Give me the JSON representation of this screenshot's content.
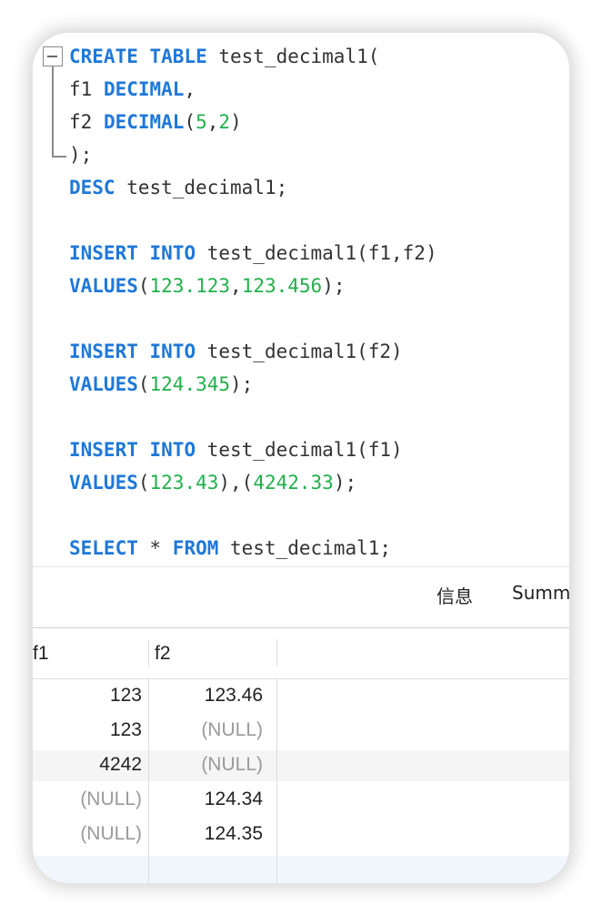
{
  "editor": {
    "lines": [
      [
        {
          "t": "CREATE",
          "k": "kw"
        },
        {
          "t": " ",
          "k": "plain"
        },
        {
          "t": "TABLE",
          "k": "kw"
        },
        {
          "t": " test_decimal1(",
          "k": "plain"
        }
      ],
      [
        {
          "t": "f1 ",
          "k": "plain"
        },
        {
          "t": "DECIMAL",
          "k": "kw"
        },
        {
          "t": ",",
          "k": "plain"
        }
      ],
      [
        {
          "t": "f2 ",
          "k": "plain"
        },
        {
          "t": "DECIMAL",
          "k": "kw"
        },
        {
          "t": "(",
          "k": "plain"
        },
        {
          "t": "5",
          "k": "num"
        },
        {
          "t": ",",
          "k": "plain"
        },
        {
          "t": "2",
          "k": "num"
        },
        {
          "t": ")",
          "k": "plain"
        }
      ],
      [
        {
          "t": ");",
          "k": "plain"
        }
      ],
      [
        {
          "t": "DESC",
          "k": "kw"
        },
        {
          "t": " test_decimal1;",
          "k": "plain"
        }
      ],
      [],
      [
        {
          "t": "INSERT",
          "k": "kw"
        },
        {
          "t": " ",
          "k": "plain"
        },
        {
          "t": "INTO",
          "k": "kw"
        },
        {
          "t": " test_decimal1(f1,f2)",
          "k": "plain"
        }
      ],
      [
        {
          "t": "VALUES",
          "k": "kw"
        },
        {
          "t": "(",
          "k": "plain"
        },
        {
          "t": "123.123",
          "k": "num"
        },
        {
          "t": ",",
          "k": "plain"
        },
        {
          "t": "123.456",
          "k": "num"
        },
        {
          "t": ");",
          "k": "plain"
        }
      ],
      [],
      [
        {
          "t": "INSERT",
          "k": "kw"
        },
        {
          "t": " ",
          "k": "plain"
        },
        {
          "t": "INTO",
          "k": "kw"
        },
        {
          "t": " test_decimal1(f2)",
          "k": "plain"
        }
      ],
      [
        {
          "t": "VALUES",
          "k": "kw"
        },
        {
          "t": "(",
          "k": "plain"
        },
        {
          "t": "124.345",
          "k": "num"
        },
        {
          "t": ");",
          "k": "plain"
        }
      ],
      [],
      [
        {
          "t": "INSERT",
          "k": "kw"
        },
        {
          "t": " ",
          "k": "plain"
        },
        {
          "t": "INTO",
          "k": "kw"
        },
        {
          "t": " test_decimal1(f1)",
          "k": "plain"
        }
      ],
      [
        {
          "t": "VALUES",
          "k": "kw"
        },
        {
          "t": "(",
          "k": "plain"
        },
        {
          "t": "123.43",
          "k": "num"
        },
        {
          "t": "),(",
          "k": "plain"
        },
        {
          "t": "4242.33",
          "k": "num"
        },
        {
          "t": ");",
          "k": "plain"
        }
      ],
      [],
      [
        {
          "t": "SELECT",
          "k": "kw"
        },
        {
          "t": " * ",
          "k": "plain"
        },
        {
          "t": "FROM",
          "k": "kw"
        },
        {
          "t": " test_decimal1;",
          "k": "plain"
        }
      ]
    ]
  },
  "tabs": {
    "info": "信息",
    "summary": "Summ"
  },
  "results": {
    "columns": [
      "f1",
      "f2"
    ],
    "rows": [
      [
        "123",
        "123.46"
      ],
      [
        "123",
        "(NULL)"
      ],
      [
        "4242",
        "(NULL)"
      ],
      [
        "(NULL)",
        "124.34"
      ],
      [
        "(NULL)",
        "124.35"
      ]
    ]
  }
}
